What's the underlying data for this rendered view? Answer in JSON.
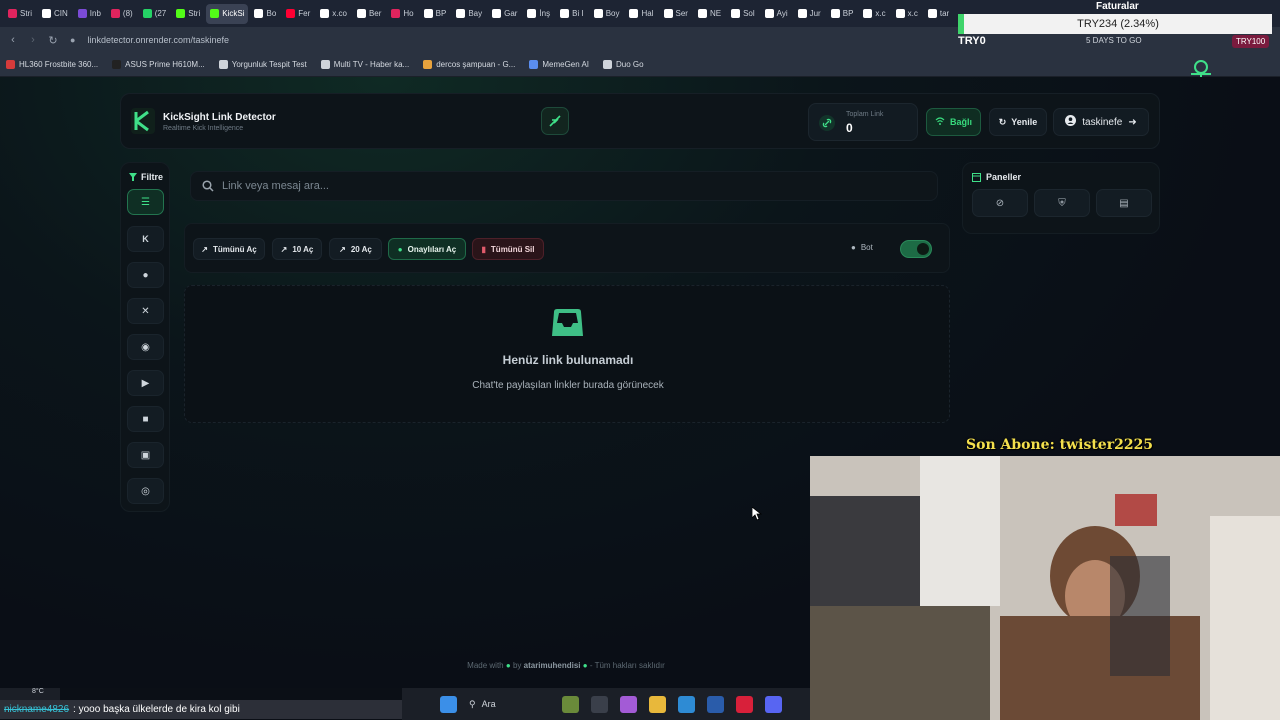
{
  "browser": {
    "tabs": [
      {
        "label": "Stri",
        "color": "#e0245e"
      },
      {
        "label": "CIN",
        "color": "#ffffff"
      },
      {
        "label": "Inb",
        "color": "#7b4bd6"
      },
      {
        "label": "(8)",
        "color": "#e0245e"
      },
      {
        "label": "(27",
        "color": "#25d366"
      },
      {
        "label": "Stri",
        "color": "#53fc18"
      },
      {
        "label": "KickSi",
        "color": "#53fc18",
        "active": true
      },
      {
        "label": "Bo",
        "color": "#ffffff"
      },
      {
        "label": "Fer",
        "color": "#ff0033"
      },
      {
        "label": "x.co",
        "color": "#ffffff"
      },
      {
        "label": "Ber",
        "color": "#ffffff"
      },
      {
        "label": "Ho",
        "color": "#e0245e"
      },
      {
        "label": "BP",
        "color": "#ffffff"
      },
      {
        "label": "Bay",
        "color": "#ffffff"
      },
      {
        "label": "Gar",
        "color": "#ffffff"
      },
      {
        "label": "İnş",
        "color": "#ffffff"
      },
      {
        "label": "Bi I",
        "color": "#ffffff"
      },
      {
        "label": "Boy",
        "color": "#ffffff"
      },
      {
        "label": "Hal",
        "color": "#ffffff"
      },
      {
        "label": "Ser",
        "color": "#ffffff"
      },
      {
        "label": "NE",
        "color": "#ffffff"
      },
      {
        "label": "Sol",
        "color": "#ffffff"
      },
      {
        "label": "Ayi",
        "color": "#ffffff"
      },
      {
        "label": "Jur",
        "color": "#ffffff"
      },
      {
        "label": "BP",
        "color": "#ffffff"
      },
      {
        "label": "x.c",
        "color": "#ffffff"
      },
      {
        "label": "x.c",
        "color": "#ffffff"
      },
      {
        "label": "tar",
        "color": "#ffffff"
      }
    ],
    "url": "linkdetector.onrender.com/taskinefe",
    "bookmarks": [
      {
        "label": "HL360 Frostbite 360...",
        "color": "#d63b3b"
      },
      {
        "label": "ASUS Prime H610M...",
        "color": "#222222"
      },
      {
        "label": "Yorgunluk Tespit Test",
        "color": "#cfd4db"
      },
      {
        "label": "Multi TV - Haber ka...",
        "color": "#cfd4db"
      },
      {
        "label": "dercos şampuan - G...",
        "color": "#e8a33d"
      },
      {
        "label": "MemeGen AI",
        "color": "#5a8dee"
      },
      {
        "label": "Duo Go",
        "color": "#cfd4db"
      }
    ]
  },
  "overlay": {
    "ticker_title": "Faturalar",
    "ticker_text": "TRY234 (2.34%)",
    "try_left": "TRY0",
    "days_text": "5 DAYS TO GO",
    "try_right": "TRY100",
    "sub_alert": "Son Abone: twister2225"
  },
  "header": {
    "title": "KickSight Link Detector",
    "subtitle": "Realtime Kick Intelligence",
    "count_label": "Toplam Link",
    "count_value": "0",
    "connected_label": "Bağlı",
    "refresh_label": "Yenile",
    "username": "taskinefe"
  },
  "filter": {
    "title": "Filtre",
    "items": [
      "list-icon",
      "kick-icon",
      "user-icon",
      "x-icon",
      "instagram-icon",
      "youtube-icon",
      "video-icon",
      "camera-icon",
      "globe-icon"
    ]
  },
  "search": {
    "placeholder": "Link veya mesaj ara..."
  },
  "actions": {
    "open_all": "Tümünü Aç",
    "open_10": "10 Aç",
    "open_20": "20 Aç",
    "open_approved": "Onaylıları Aç",
    "delete_all": "Tümünü Sil",
    "bot_label": "Bot",
    "bot_enabled": true
  },
  "empty_state": {
    "title": "Henüz link bulunamadı",
    "subtitle": "Chat'te paylaşılan linkler burada görünecek"
  },
  "panels": {
    "title": "Paneller"
  },
  "footer": {
    "made_with": "Made with",
    "by": "by",
    "author": "atarimuhendisi",
    "rights": "- Tüm hakları saklıdır"
  },
  "taskbar": {
    "weather": "8°C",
    "search": "Ara",
    "notif_count": "2"
  },
  "chat": {
    "user": "nickname4826",
    "message": ": yooo başka ülkelerde de kira kol gibi"
  },
  "colors": {
    "accent": "#3fe089",
    "background": "#0b0f16"
  }
}
